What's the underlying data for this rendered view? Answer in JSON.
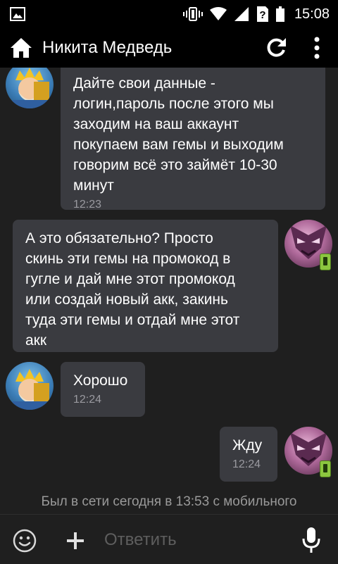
{
  "status_bar": {
    "time": "15:08"
  },
  "header": {
    "title": "Никита Медведь"
  },
  "messages": [
    {
      "side": "in",
      "text": "Дайте свои данные -\nлогин,пароль после этого мы\nзаходим на ваш аккаунт\nпокупаем вам гемы и выходим\nговорим всё это займёт 10-30\nминут",
      "time": "12:23"
    },
    {
      "side": "out",
      "text": "А это обязательно? Просто\nскинь эти гемы на промокод в\nгугле и дай мне этот промокод\nили создай новый акк, закинь\nтуда эти гемы и отдай мне этот\nакк",
      "time": ""
    },
    {
      "side": "in",
      "text": "Хорошо",
      "time": "12:24"
    },
    {
      "side": "out",
      "text": "Жду",
      "time": "12:24"
    }
  ],
  "last_seen": "Был в сети сегодня в 13:53 с мобильного",
  "composer": {
    "placeholder": "Ответить",
    "icons": [
      "smile-icon",
      "plus-icon",
      "microphone-icon"
    ]
  }
}
